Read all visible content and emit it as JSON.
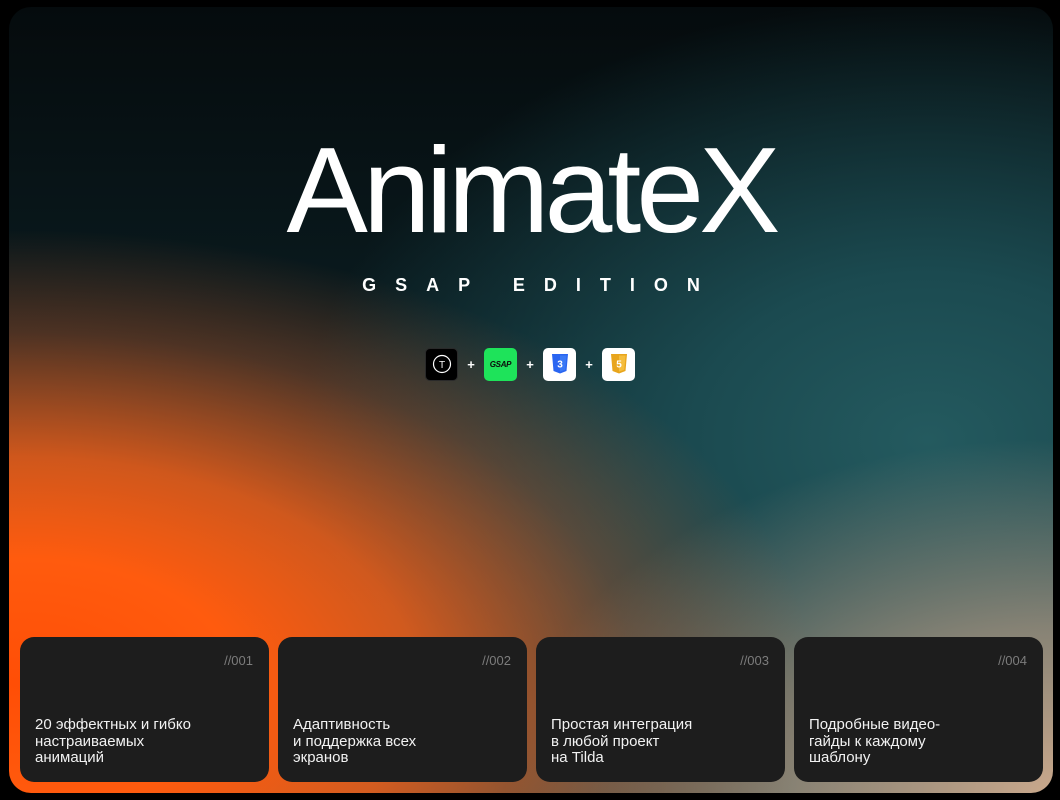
{
  "hero": {
    "title": "AnimateX",
    "subtitle": "GSAP EDITION"
  },
  "tech_stack": {
    "items": [
      {
        "icon": "tilda-icon",
        "label": "T"
      },
      {
        "icon": "gsap-icon",
        "label": "GSAP"
      },
      {
        "icon": "css3-icon",
        "label": "3"
      },
      {
        "icon": "html5-icon",
        "label": "5"
      }
    ],
    "separator": "+"
  },
  "features": [
    {
      "number": "//001",
      "text": "20 эффектных и гибко\nнастраиваемых\nанимаций"
    },
    {
      "number": "//002",
      "text": "Адаптивность\nи поддержка всех\nэкранов"
    },
    {
      "number": "//003",
      "text": "Простая интеграция\nв любой проект\nна Tilda"
    },
    {
      "number": "//004",
      "text": "Подробные видео-\nгайды к каждому\nшаблону"
    }
  ],
  "colors": {
    "accent_orange": "#ff5b0e",
    "teal": "#1b4a50",
    "gsap_green": "#1ee35a",
    "css_blue": "#2965f1",
    "html_gold": "#f0b42a",
    "card_bg": "#1d1d1d"
  }
}
